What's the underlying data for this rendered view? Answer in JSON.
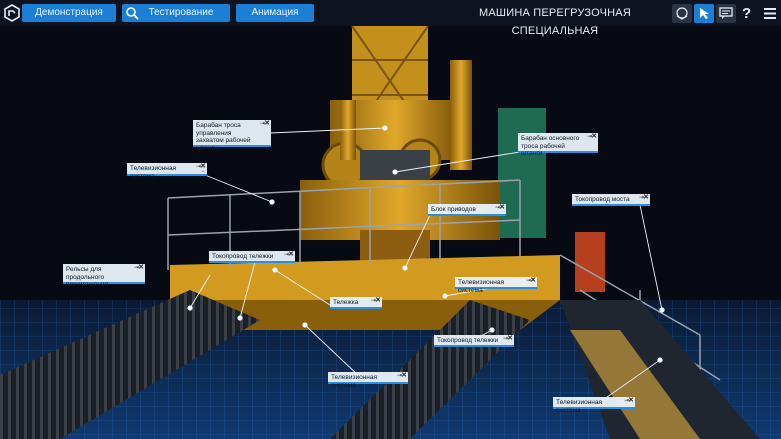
{
  "toolbar": {
    "demo_label": "Демонстрация",
    "test_label": "Тестирование",
    "anim_label": "Анимация"
  },
  "title": "МАШИНА ПЕРЕГРУЗОЧНАЯ СПЕЦИАЛЬНАЯ",
  "icons": {
    "logo": "app-logo",
    "search": "search-icon",
    "layers": "layers-icon",
    "pointer": "pointer-icon",
    "chat": "chat-icon",
    "help": "help-icon",
    "menu": "menu-icon"
  },
  "help_glyph": "?",
  "label_controls": {
    "pin": "⇥",
    "close": "✕",
    "expand": "⌄"
  },
  "callouts": [
    {
      "text": "Барабан троса управления захватом рабочей штанги"
    },
    {
      "text": "Барабан основного троса рабочей штанги"
    },
    {
      "text": "Телевизионная система"
    },
    {
      "text": "Блок приводов"
    },
    {
      "text": "Токопровод моста"
    },
    {
      "text": "Токопровод тележки"
    },
    {
      "text": "Рельсы для продольного перемещения"
    },
    {
      "text": "Телевизионная система"
    },
    {
      "text": "Тележка"
    },
    {
      "text": "Токопровод тележки"
    },
    {
      "text": "Телевизионная система"
    },
    {
      "text": "Телевизионная система"
    }
  ],
  "colors": {
    "accent": "#1c7fd6",
    "label_bg": "#e8f0f8",
    "machine_yellow": "#d9a21a",
    "background": "#070a12"
  }
}
